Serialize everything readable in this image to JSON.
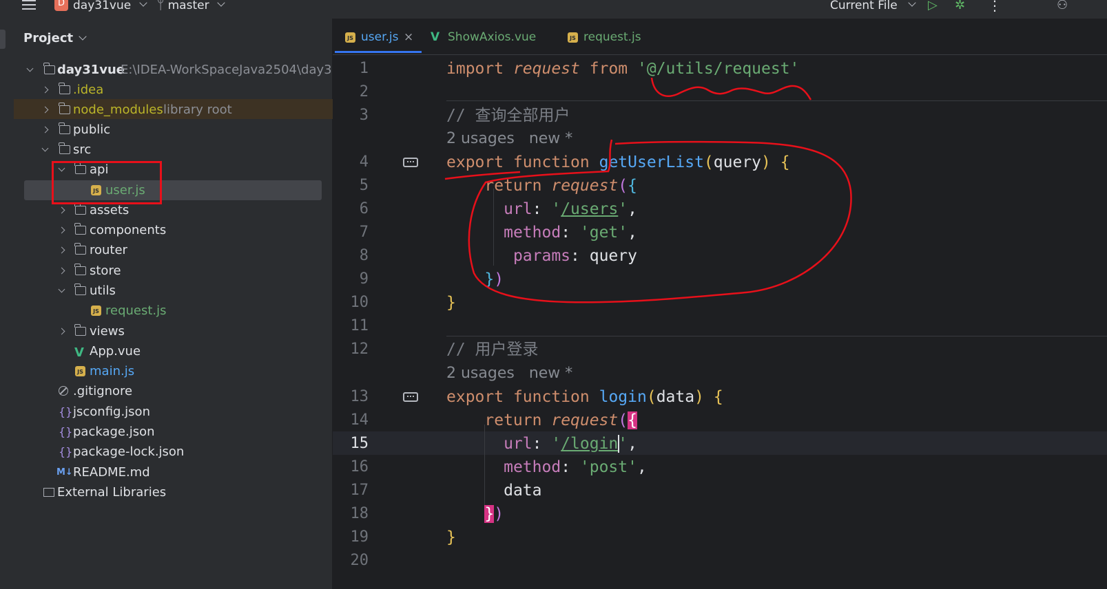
{
  "topbar": {
    "project_badge": "D",
    "project_name": "day31vue",
    "branch": "master",
    "run_config": "Current File",
    "more": "⋮"
  },
  "project_panel": {
    "title": "Project",
    "root_name": "day31vue",
    "root_path": "E:\\IDEA-WorkSpaceJava2504\\day31v",
    "items": [
      {
        "label": ".idea"
      },
      {
        "label": "node_modules",
        "note": "library root"
      },
      {
        "label": "public"
      },
      {
        "label": "src"
      },
      {
        "label": "api"
      },
      {
        "label": "user.js"
      },
      {
        "label": "assets"
      },
      {
        "label": "components"
      },
      {
        "label": "router"
      },
      {
        "label": "store"
      },
      {
        "label": "utils"
      },
      {
        "label": "request.js"
      },
      {
        "label": "views"
      },
      {
        "label": "App.vue"
      },
      {
        "label": "main.js"
      },
      {
        "label": ".gitignore"
      },
      {
        "label": "jsconfig.json"
      },
      {
        "label": "package.json"
      },
      {
        "label": "package-lock.json"
      },
      {
        "label": "README.md"
      },
      {
        "label": "External Libraries"
      }
    ]
  },
  "tabs": [
    {
      "label": "user.js",
      "active": true
    },
    {
      "label": "ShowAxios.vue"
    },
    {
      "label": "request.js"
    }
  ],
  "tab_close": "×",
  "icons": {
    "js": "JS",
    "vue": "V",
    "json": "{}",
    "md": "M↓"
  },
  "line_numbers": [
    "1",
    "2",
    "3",
    "4",
    "5",
    "6",
    "7",
    "8",
    "9",
    "10",
    "11",
    "12",
    "13",
    "14",
    "15",
    "16",
    "17",
    "18",
    "19",
    "20"
  ],
  "code": {
    "l1": {
      "kw1": "import",
      "id": "request",
      "kw2": "from",
      "str": "'@/utils/request'"
    },
    "l3": {
      "comment": "// 查询全部用户"
    },
    "hint": "2 usages   new *",
    "l4": {
      "kw1": "export",
      "kw2": "function",
      "fn": "getUserList",
      "arg": "query"
    },
    "l5": {
      "kw": "return",
      "fn": "request"
    },
    "l6": {
      "prop": "url",
      "str_q": "'",
      "str_path": "/users"
    },
    "l7": {
      "prop": "method",
      "str": "'get'"
    },
    "l8": {
      "prop": "params",
      "val": "query"
    },
    "l12": {
      "comment": "// 用户登录"
    },
    "l13": {
      "kw1": "export",
      "kw2": "function",
      "fn": "login",
      "arg": "data"
    },
    "l14": {
      "kw": "return",
      "fn": "request"
    },
    "l15": {
      "prop": "url",
      "str_path": "/login"
    },
    "l16": {
      "prop": "method",
      "str": "'post'"
    },
    "l17": {
      "val": "data"
    }
  },
  "colors": {
    "annotation": "#e8101a",
    "accent": "#3574f0"
  }
}
